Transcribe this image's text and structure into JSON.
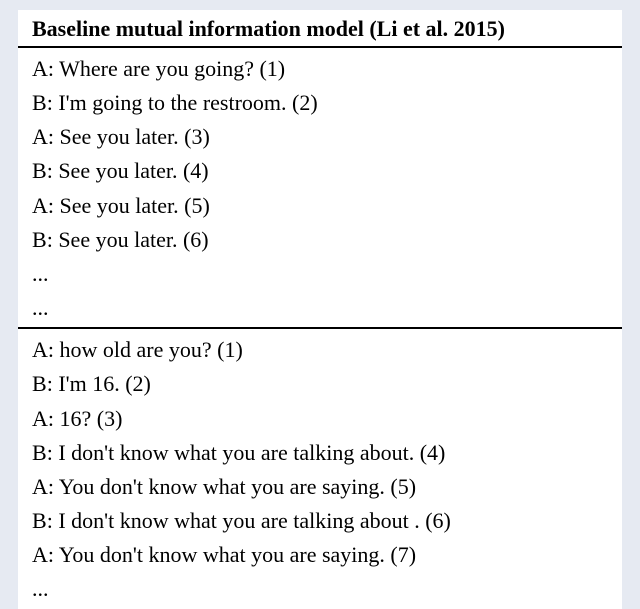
{
  "header": "Baseline mutual information model (Li et al. 2015)",
  "dialogues": [
    {
      "turns": [
        {
          "speaker": "A",
          "text": "Where are you going?",
          "n": "(1)"
        },
        {
          "speaker": "B",
          "text": "I'm going to the restroom.",
          "n": "(2)"
        },
        {
          "speaker": "A",
          "text": "See you later.",
          "n": "(3)"
        },
        {
          "speaker": "B",
          "text": "See you later.",
          "n": "(4)"
        },
        {
          "speaker": "A",
          "text": "See you later.",
          "n": "(5)"
        },
        {
          "speaker": "B",
          "text": "See you later.",
          "n": "(6)"
        }
      ],
      "trailing": [
        "...",
        "..."
      ]
    },
    {
      "turns": [
        {
          "speaker": "A",
          "text": "how old are you?",
          "n": "(1)"
        },
        {
          "speaker": "B",
          "text": "I'm 16.",
          "n": "(2)"
        },
        {
          "speaker": "A",
          "text": "16?",
          "n": "(3)"
        },
        {
          "speaker": "B",
          "text": "I don't know what you are talking about.",
          "n": "(4)"
        },
        {
          "speaker": "A",
          "text": "You don't know what you are saying.",
          "n": "(5)"
        },
        {
          "speaker": "B",
          "text": "I don't know what you are talking about .",
          "n": "(6)"
        },
        {
          "speaker": "A",
          "text": "You don't know what you are saying.",
          "n": "(7)"
        }
      ],
      "trailing": [
        "..."
      ]
    }
  ]
}
